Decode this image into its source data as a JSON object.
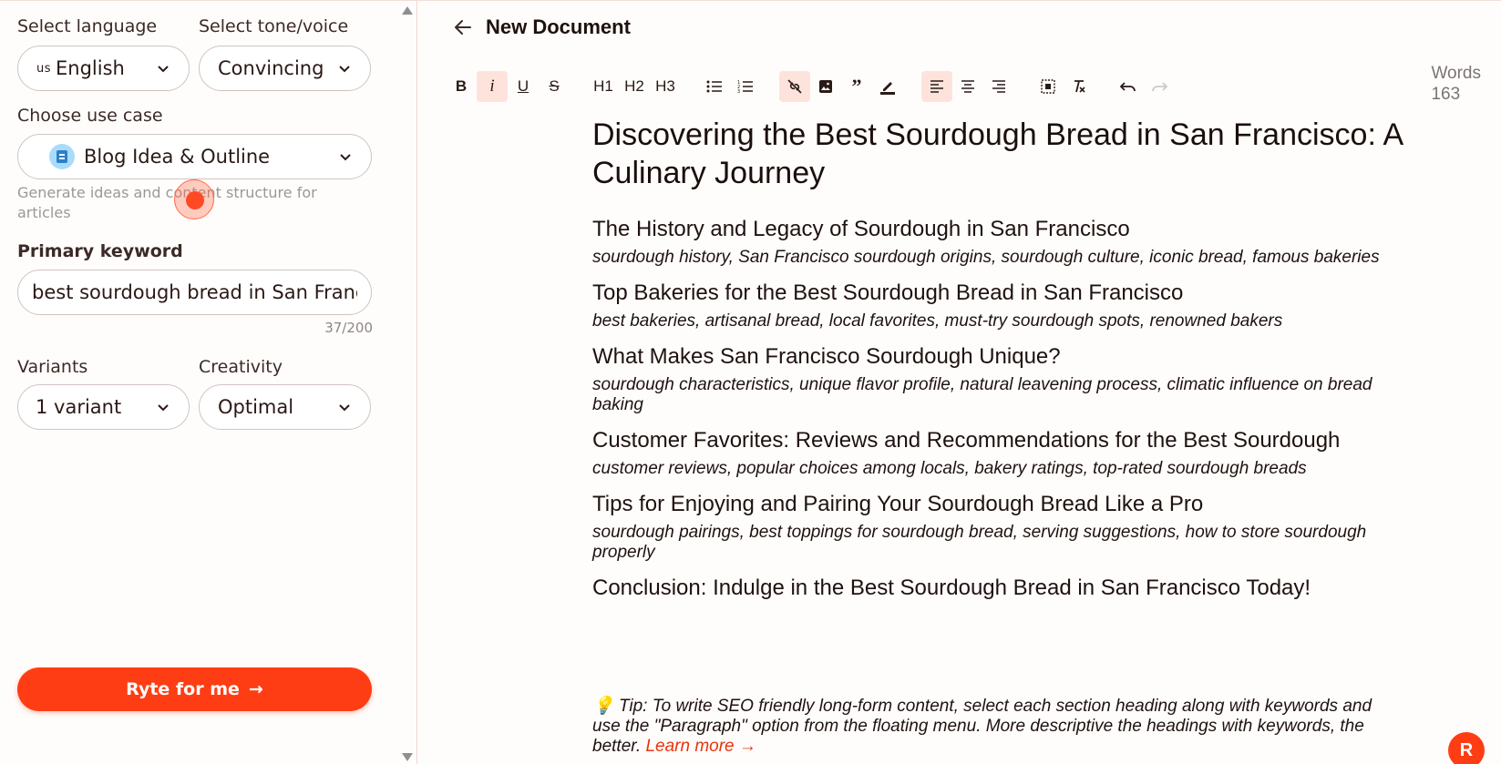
{
  "sidebar": {
    "language": {
      "label": "Select language",
      "prefix": "us",
      "value": "English"
    },
    "tone": {
      "label": "Select tone/voice",
      "value": "Convincing"
    },
    "use_case": {
      "label": "Choose use case",
      "value": "Blog Idea & Outline",
      "description": "Generate ideas and content structure for articles"
    },
    "keyword": {
      "label": "Primary keyword",
      "value": "best sourdough bread in San Francisco",
      "counter": "37/200"
    },
    "variants": {
      "label": "Variants",
      "value": "1 variant"
    },
    "creativity": {
      "label": "Creativity",
      "value": "Optimal"
    },
    "ryte_button": {
      "label": "Ryte for me",
      "arrow": "→"
    }
  },
  "main": {
    "title": "New Document",
    "words": {
      "label": "Words",
      "count": "163"
    },
    "toolbar": {
      "bold": "B",
      "italic": "i",
      "underline": "U",
      "strike": "S",
      "h1": "H1",
      "h2": "H2",
      "h3": "H3"
    },
    "document": {
      "title": "Discovering the Best Sourdough Bread in San Francisco: A Culinary Journey",
      "sections": [
        {
          "heading": "The History and Legacy of Sourdough in San Francisco",
          "keywords": "sourdough history, San Francisco sourdough origins, sourdough culture, iconic bread, famous bakeries"
        },
        {
          "heading": "Top Bakeries for the Best Sourdough Bread in San Francisco",
          "keywords": "best bakeries, artisanal bread, local favorites, must-try sourdough spots, renowned bakers"
        },
        {
          "heading": "What Makes San Francisco Sourdough Unique?",
          "keywords": "sourdough characteristics, unique flavor profile, natural leavening process, climatic influence on bread baking"
        },
        {
          "heading": "Customer Favorites: Reviews and Recommendations for the Best Sourdough",
          "keywords": "customer reviews, popular choices among locals, bakery ratings, top-rated sourdough breads"
        },
        {
          "heading": "Tips for Enjoying and Pairing Your Sourdough Bread Like a Pro",
          "keywords": "sourdough pairings, best toppings for sourdough bread, serving suggestions, how to store sourdough properly"
        },
        {
          "heading": "Conclusion: Indulge in the Best Sourdough Bread in San Francisco Today!",
          "keywords": ""
        }
      ],
      "tip": {
        "emoji": "💡",
        "text": " Tip: To write SEO friendly long-form content, select each section heading along with keywords and use the \"Paragraph\" option from the floating menu. More descriptive the headings with keywords, the better. ",
        "learn_more": "Learn more →"
      }
    },
    "fab_label": "R"
  },
  "colors": {
    "accent": "#ff3d14",
    "active_bg": "#fde3dc",
    "usecase_icon": "#a9dcfb"
  },
  "icons": [
    "chevron-down-icon",
    "back-arrow-icon",
    "bullet-list-icon",
    "numbered-list-icon",
    "unlink-icon",
    "image-icon",
    "quote-icon",
    "highlight-icon",
    "align-left-icon",
    "align-center-icon",
    "align-right-icon",
    "select-all-icon",
    "clear-format-icon",
    "undo-icon",
    "redo-icon"
  ]
}
